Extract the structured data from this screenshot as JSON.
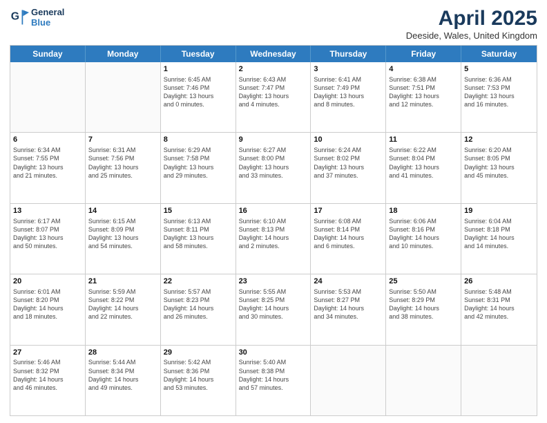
{
  "logo": {
    "line1": "General",
    "line2": "Blue"
  },
  "title": "April 2025",
  "subtitle": "Deeside, Wales, United Kingdom",
  "weekdays": [
    "Sunday",
    "Monday",
    "Tuesday",
    "Wednesday",
    "Thursday",
    "Friday",
    "Saturday"
  ],
  "rows": [
    [
      {
        "day": "",
        "info": ""
      },
      {
        "day": "",
        "info": ""
      },
      {
        "day": "1",
        "info": "Sunrise: 6:45 AM\nSunset: 7:46 PM\nDaylight: 13 hours\nand 0 minutes."
      },
      {
        "day": "2",
        "info": "Sunrise: 6:43 AM\nSunset: 7:47 PM\nDaylight: 13 hours\nand 4 minutes."
      },
      {
        "day": "3",
        "info": "Sunrise: 6:41 AM\nSunset: 7:49 PM\nDaylight: 13 hours\nand 8 minutes."
      },
      {
        "day": "4",
        "info": "Sunrise: 6:38 AM\nSunset: 7:51 PM\nDaylight: 13 hours\nand 12 minutes."
      },
      {
        "day": "5",
        "info": "Sunrise: 6:36 AM\nSunset: 7:53 PM\nDaylight: 13 hours\nand 16 minutes."
      }
    ],
    [
      {
        "day": "6",
        "info": "Sunrise: 6:34 AM\nSunset: 7:55 PM\nDaylight: 13 hours\nand 21 minutes."
      },
      {
        "day": "7",
        "info": "Sunrise: 6:31 AM\nSunset: 7:56 PM\nDaylight: 13 hours\nand 25 minutes."
      },
      {
        "day": "8",
        "info": "Sunrise: 6:29 AM\nSunset: 7:58 PM\nDaylight: 13 hours\nand 29 minutes."
      },
      {
        "day": "9",
        "info": "Sunrise: 6:27 AM\nSunset: 8:00 PM\nDaylight: 13 hours\nand 33 minutes."
      },
      {
        "day": "10",
        "info": "Sunrise: 6:24 AM\nSunset: 8:02 PM\nDaylight: 13 hours\nand 37 minutes."
      },
      {
        "day": "11",
        "info": "Sunrise: 6:22 AM\nSunset: 8:04 PM\nDaylight: 13 hours\nand 41 minutes."
      },
      {
        "day": "12",
        "info": "Sunrise: 6:20 AM\nSunset: 8:05 PM\nDaylight: 13 hours\nand 45 minutes."
      }
    ],
    [
      {
        "day": "13",
        "info": "Sunrise: 6:17 AM\nSunset: 8:07 PM\nDaylight: 13 hours\nand 50 minutes."
      },
      {
        "day": "14",
        "info": "Sunrise: 6:15 AM\nSunset: 8:09 PM\nDaylight: 13 hours\nand 54 minutes."
      },
      {
        "day": "15",
        "info": "Sunrise: 6:13 AM\nSunset: 8:11 PM\nDaylight: 13 hours\nand 58 minutes."
      },
      {
        "day": "16",
        "info": "Sunrise: 6:10 AM\nSunset: 8:13 PM\nDaylight: 14 hours\nand 2 minutes."
      },
      {
        "day": "17",
        "info": "Sunrise: 6:08 AM\nSunset: 8:14 PM\nDaylight: 14 hours\nand 6 minutes."
      },
      {
        "day": "18",
        "info": "Sunrise: 6:06 AM\nSunset: 8:16 PM\nDaylight: 14 hours\nand 10 minutes."
      },
      {
        "day": "19",
        "info": "Sunrise: 6:04 AM\nSunset: 8:18 PM\nDaylight: 14 hours\nand 14 minutes."
      }
    ],
    [
      {
        "day": "20",
        "info": "Sunrise: 6:01 AM\nSunset: 8:20 PM\nDaylight: 14 hours\nand 18 minutes."
      },
      {
        "day": "21",
        "info": "Sunrise: 5:59 AM\nSunset: 8:22 PM\nDaylight: 14 hours\nand 22 minutes."
      },
      {
        "day": "22",
        "info": "Sunrise: 5:57 AM\nSunset: 8:23 PM\nDaylight: 14 hours\nand 26 minutes."
      },
      {
        "day": "23",
        "info": "Sunrise: 5:55 AM\nSunset: 8:25 PM\nDaylight: 14 hours\nand 30 minutes."
      },
      {
        "day": "24",
        "info": "Sunrise: 5:53 AM\nSunset: 8:27 PM\nDaylight: 14 hours\nand 34 minutes."
      },
      {
        "day": "25",
        "info": "Sunrise: 5:50 AM\nSunset: 8:29 PM\nDaylight: 14 hours\nand 38 minutes."
      },
      {
        "day": "26",
        "info": "Sunrise: 5:48 AM\nSunset: 8:31 PM\nDaylight: 14 hours\nand 42 minutes."
      }
    ],
    [
      {
        "day": "27",
        "info": "Sunrise: 5:46 AM\nSunset: 8:32 PM\nDaylight: 14 hours\nand 46 minutes."
      },
      {
        "day": "28",
        "info": "Sunrise: 5:44 AM\nSunset: 8:34 PM\nDaylight: 14 hours\nand 49 minutes."
      },
      {
        "day": "29",
        "info": "Sunrise: 5:42 AM\nSunset: 8:36 PM\nDaylight: 14 hours\nand 53 minutes."
      },
      {
        "day": "30",
        "info": "Sunrise: 5:40 AM\nSunset: 8:38 PM\nDaylight: 14 hours\nand 57 minutes."
      },
      {
        "day": "",
        "info": ""
      },
      {
        "day": "",
        "info": ""
      },
      {
        "day": "",
        "info": ""
      }
    ]
  ]
}
